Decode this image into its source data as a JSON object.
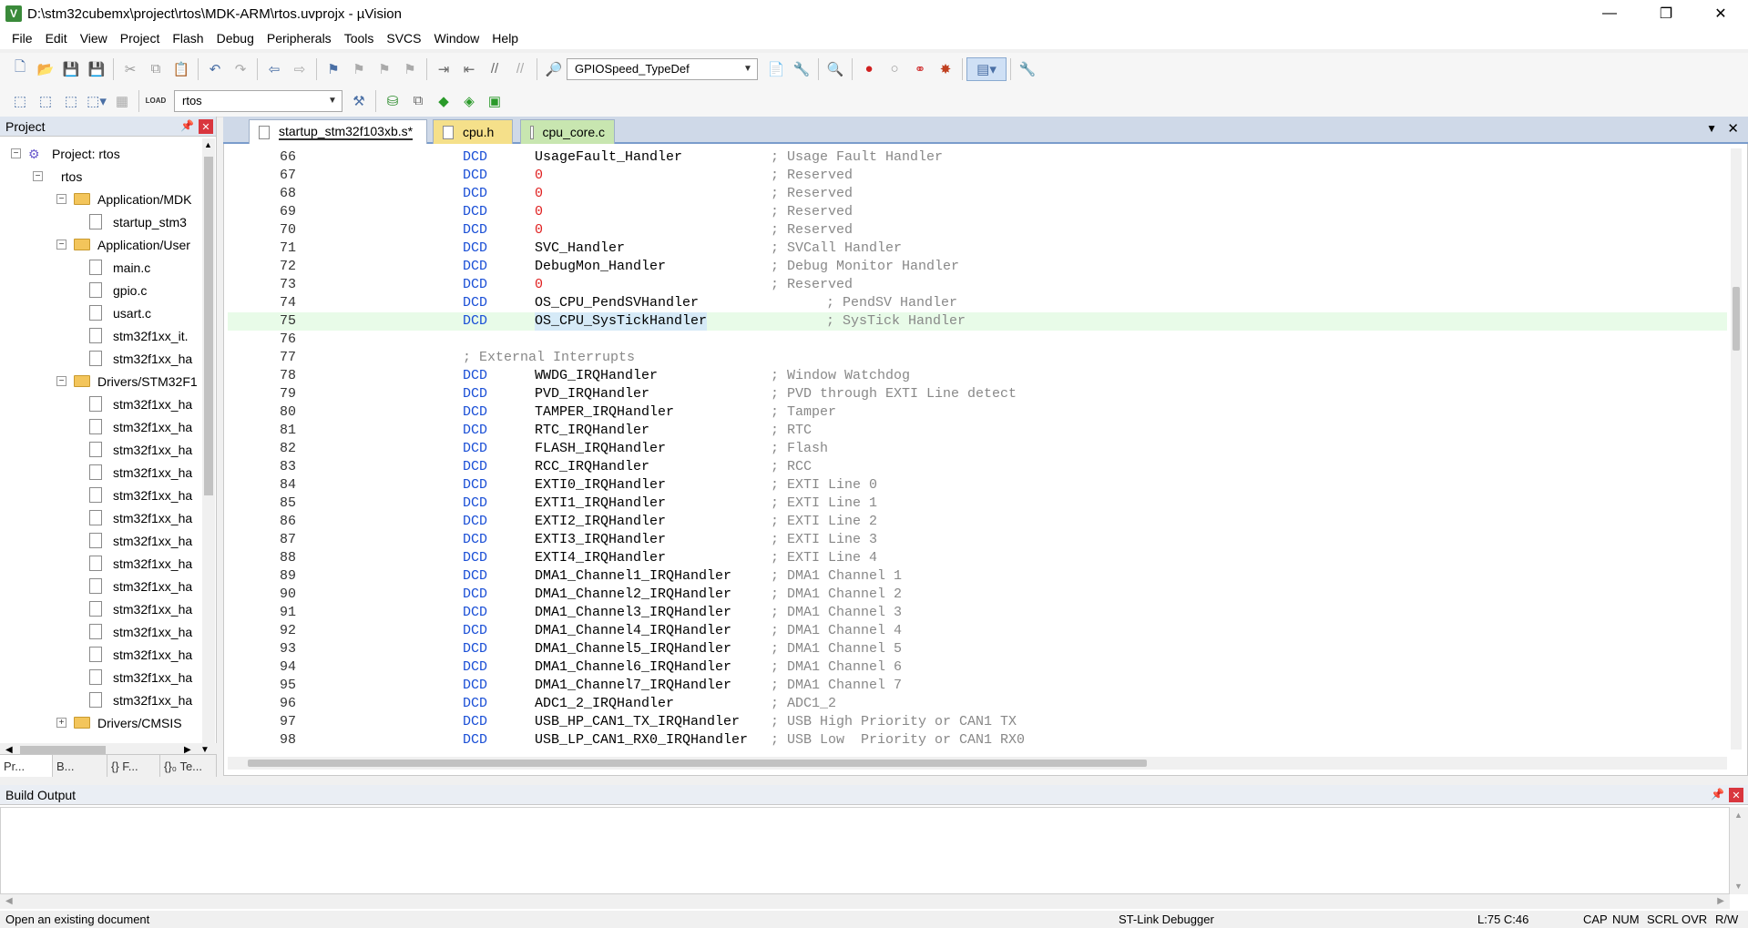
{
  "window": {
    "title": "D:\\stm32cubemx\\project\\rtos\\MDK-ARM\\rtos.uvprojx - µVision",
    "app_icon": "V",
    "controls": [
      "—",
      "❐",
      "✕"
    ]
  },
  "menu": [
    "File",
    "Edit",
    "View",
    "Project",
    "Flash",
    "Debug",
    "Peripherals",
    "Tools",
    "SVCS",
    "Window",
    "Help"
  ],
  "toolbar1": {
    "find_combo": "GPIOSpeed_TypeDef"
  },
  "toolbar2": {
    "target_combo": "rtos",
    "load_label": "LOAD"
  },
  "project_panel": {
    "title": "Project",
    "tree": [
      {
        "label": "Project: rtos",
        "level": 0,
        "kind": "project",
        "expander": "−"
      },
      {
        "label": "rtos",
        "level": 1,
        "kind": "target",
        "expander": "−"
      },
      {
        "label": "Application/MDK",
        "level": 2,
        "kind": "folder",
        "expander": "−"
      },
      {
        "label": "startup_stm3",
        "level": 3,
        "kind": "file"
      },
      {
        "label": "Application/User",
        "level": 2,
        "kind": "folder",
        "expander": "−"
      },
      {
        "label": "main.c",
        "level": 3,
        "kind": "file"
      },
      {
        "label": "gpio.c",
        "level": 3,
        "kind": "file"
      },
      {
        "label": "usart.c",
        "level": 3,
        "kind": "file"
      },
      {
        "label": "stm32f1xx_it.",
        "level": 3,
        "kind": "file"
      },
      {
        "label": "stm32f1xx_ha",
        "level": 3,
        "kind": "file"
      },
      {
        "label": "Drivers/STM32F1",
        "level": 2,
        "kind": "folder",
        "expander": "−"
      },
      {
        "label": "stm32f1xx_ha",
        "level": 3,
        "kind": "file"
      },
      {
        "label": "stm32f1xx_ha",
        "level": 3,
        "kind": "file"
      },
      {
        "label": "stm32f1xx_ha",
        "level": 3,
        "kind": "file"
      },
      {
        "label": "stm32f1xx_ha",
        "level": 3,
        "kind": "file"
      },
      {
        "label": "stm32f1xx_ha",
        "level": 3,
        "kind": "file"
      },
      {
        "label": "stm32f1xx_ha",
        "level": 3,
        "kind": "file"
      },
      {
        "label": "stm32f1xx_ha",
        "level": 3,
        "kind": "file"
      },
      {
        "label": "stm32f1xx_ha",
        "level": 3,
        "kind": "file"
      },
      {
        "label": "stm32f1xx_ha",
        "level": 3,
        "kind": "file"
      },
      {
        "label": "stm32f1xx_ha",
        "level": 3,
        "kind": "file"
      },
      {
        "label": "stm32f1xx_ha",
        "level": 3,
        "kind": "file"
      },
      {
        "label": "stm32f1xx_ha",
        "level": 3,
        "kind": "file"
      },
      {
        "label": "stm32f1xx_ha",
        "level": 3,
        "kind": "file"
      },
      {
        "label": "stm32f1xx_ha",
        "level": 3,
        "kind": "file"
      },
      {
        "label": "Drivers/CMSIS",
        "level": 2,
        "kind": "folder",
        "expander": "+"
      }
    ],
    "bottom_tabs": [
      "Pr...",
      "B...",
      "{} F...",
      "{}₀ Te..."
    ]
  },
  "editor": {
    "tabs": [
      {
        "label": "startup_stm32f103xb.s*",
        "active": true,
        "color": "#ffffff"
      },
      {
        "label": "cpu.h",
        "active": false,
        "color": "#f5e08a"
      },
      {
        "label": "cpu_core.c",
        "active": false,
        "color": "#c8e6b0"
      }
    ],
    "highlight_line": 75,
    "lines": [
      {
        "n": "66",
        "kw": "DCD",
        "arg": "UsageFault_Handler",
        "cm": "; Usage Fault Handler",
        "ci": 0
      },
      {
        "n": "67",
        "kw": "DCD",
        "arg": "0",
        "cm": "; Reserved",
        "ci": 0
      },
      {
        "n": "68",
        "kw": "DCD",
        "arg": "0",
        "cm": "; Reserved",
        "ci": 0
      },
      {
        "n": "69",
        "kw": "DCD",
        "arg": "0",
        "cm": "; Reserved",
        "ci": 0
      },
      {
        "n": "70",
        "kw": "DCD",
        "arg": "0",
        "cm": "; Reserved",
        "ci": 0
      },
      {
        "n": "71",
        "kw": "DCD",
        "arg": "SVC_Handler",
        "cm": "; SVCall Handler",
        "ci": 0
      },
      {
        "n": "72",
        "kw": "DCD",
        "arg": "DebugMon_Handler",
        "cm": "; Debug Monitor Handler",
        "ci": 0
      },
      {
        "n": "73",
        "kw": "DCD",
        "arg": "0",
        "cm": "; Reserved",
        "ci": 0
      },
      {
        "n": "74",
        "kw": "DCD",
        "arg": "OS_CPU_PendSVHandler",
        "cm": "; PendSV Handler",
        "ci": 1
      },
      {
        "n": "75",
        "kw": "DCD",
        "arg": "OS_CPU_SysTickHandler",
        "cm": "; SysTick Handler",
        "ci": 1
      },
      {
        "n": "76",
        "kw": "",
        "arg": "",
        "cm": "",
        "ci": 0
      },
      {
        "n": "77",
        "kw": "",
        "arg": "",
        "cm": "; External Interrupts",
        "ci": 2
      },
      {
        "n": "78",
        "kw": "DCD",
        "arg": "WWDG_IRQHandler",
        "cm": "; Window Watchdog",
        "ci": 0
      },
      {
        "n": "79",
        "kw": "DCD",
        "arg": "PVD_IRQHandler",
        "cm": "; PVD through EXTI Line detect",
        "ci": 0
      },
      {
        "n": "80",
        "kw": "DCD",
        "arg": "TAMPER_IRQHandler",
        "cm": "; Tamper",
        "ci": 0
      },
      {
        "n": "81",
        "kw": "DCD",
        "arg": "RTC_IRQHandler",
        "cm": "; RTC",
        "ci": 0
      },
      {
        "n": "82",
        "kw": "DCD",
        "arg": "FLASH_IRQHandler",
        "cm": "; Flash",
        "ci": 0
      },
      {
        "n": "83",
        "kw": "DCD",
        "arg": "RCC_IRQHandler",
        "cm": "; RCC",
        "ci": 0
      },
      {
        "n": "84",
        "kw": "DCD",
        "arg": "EXTI0_IRQHandler",
        "cm": "; EXTI Line 0",
        "ci": 0
      },
      {
        "n": "85",
        "kw": "DCD",
        "arg": "EXTI1_IRQHandler",
        "cm": "; EXTI Line 1",
        "ci": 0
      },
      {
        "n": "86",
        "kw": "DCD",
        "arg": "EXTI2_IRQHandler",
        "cm": "; EXTI Line 2",
        "ci": 0
      },
      {
        "n": "87",
        "kw": "DCD",
        "arg": "EXTI3_IRQHandler",
        "cm": "; EXTI Line 3",
        "ci": 0
      },
      {
        "n": "88",
        "kw": "DCD",
        "arg": "EXTI4_IRQHandler",
        "cm": "; EXTI Line 4",
        "ci": 0
      },
      {
        "n": "89",
        "kw": "DCD",
        "arg": "DMA1_Channel1_IRQHandler",
        "cm": "; DMA1 Channel 1",
        "ci": 0
      },
      {
        "n": "90",
        "kw": "DCD",
        "arg": "DMA1_Channel2_IRQHandler",
        "cm": "; DMA1 Channel 2",
        "ci": 0
      },
      {
        "n": "91",
        "kw": "DCD",
        "arg": "DMA1_Channel3_IRQHandler",
        "cm": "; DMA1 Channel 3",
        "ci": 0
      },
      {
        "n": "92",
        "kw": "DCD",
        "arg": "DMA1_Channel4_IRQHandler",
        "cm": "; DMA1 Channel 4",
        "ci": 0
      },
      {
        "n": "93",
        "kw": "DCD",
        "arg": "DMA1_Channel5_IRQHandler",
        "cm": "; DMA1 Channel 5",
        "ci": 0
      },
      {
        "n": "94",
        "kw": "DCD",
        "arg": "DMA1_Channel6_IRQHandler",
        "cm": "; DMA1 Channel 6",
        "ci": 0
      },
      {
        "n": "95",
        "kw": "DCD",
        "arg": "DMA1_Channel7_IRQHandler",
        "cm": "; DMA1 Channel 7",
        "ci": 0
      },
      {
        "n": "96",
        "kw": "DCD",
        "arg": "ADC1_2_IRQHandler",
        "cm": "; ADC1_2",
        "ci": 0
      },
      {
        "n": "97",
        "kw": "DCD",
        "arg": "USB_HP_CAN1_TX_IRQHandler",
        "cm": "; USB High Priority or CAN1 TX",
        "ci": 0
      },
      {
        "n": "98",
        "kw": "DCD",
        "arg": "USB_LP_CAN1_RX0_IRQHandler",
        "cm": "; USB Low  Priority or CAN1 RX0",
        "ci": 0
      }
    ]
  },
  "build_output": {
    "title": "Build Output",
    "content": ""
  },
  "status": {
    "message": "Open an existing document",
    "debugger": "ST-Link Debugger",
    "position": "L:75 C:46",
    "indicators": [
      "CAP",
      "NUM",
      "SCRL",
      "OVR",
      "R/W"
    ]
  },
  "colors": {
    "keyword": "#1a4fd6",
    "number": "#e02020",
    "comment": "#888888",
    "highlight": "#e8fbe8"
  }
}
